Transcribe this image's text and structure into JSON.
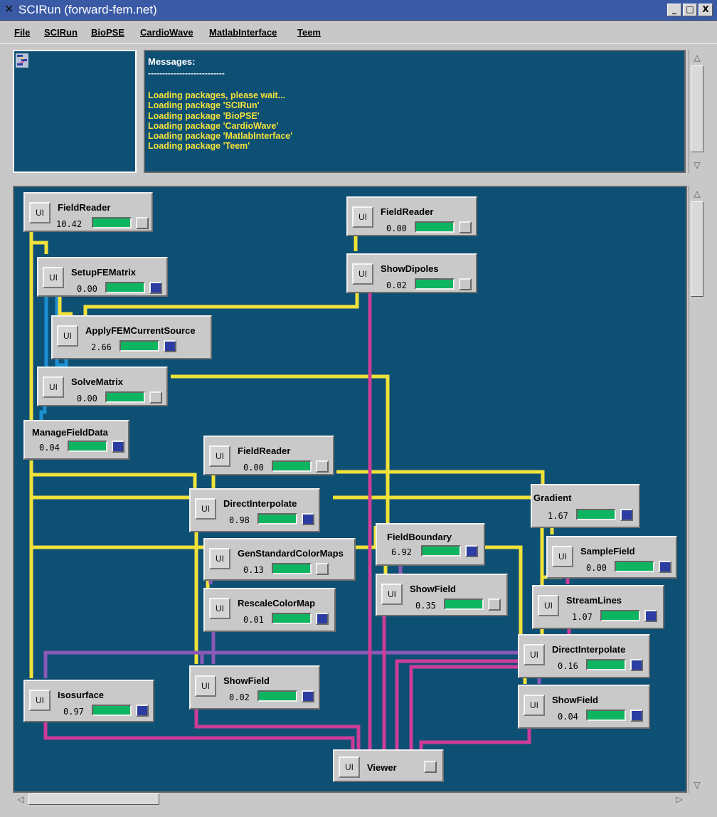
{
  "window": {
    "title": "SCIRun (forward-fem.net)",
    "controls": [
      "_",
      "□",
      "X"
    ]
  },
  "menu": [
    "File",
    "SCIRun",
    "BioPSE",
    "CardioWave",
    "MatlabInterface",
    "Teem"
  ],
  "messages": {
    "title": "Messages:",
    "rule": "---------------------------",
    "lines": [
      "Loading packages, please wait...",
      "Loading package 'SCIRun'",
      "Loading package 'BioPSE'",
      "Loading package 'CardioWave'",
      "Loading package 'MatlabInterface'",
      "Loading package 'Teem'"
    ]
  },
  "ui_label": "UI",
  "modules": {
    "field_reader_1": {
      "name": "FieldReader",
      "time": "10.42",
      "indicator": "grey"
    },
    "setup_fe_matrix": {
      "name": "SetupFEMatrix",
      "time": "0.00",
      "indicator": "blue"
    },
    "apply_fem_current_source": {
      "name": "ApplyFEMCurrentSource",
      "time": "2.66",
      "indicator": "blue"
    },
    "solve_matrix": {
      "name": "SolveMatrix",
      "time": "0.00",
      "indicator": "grey"
    },
    "manage_field_data": {
      "name": "ManageFieldData",
      "time": "0.04",
      "indicator": "blue"
    },
    "field_reader_2": {
      "name": "FieldReader",
      "time": "0.00",
      "indicator": "grey"
    },
    "show_dipoles": {
      "name": "ShowDipoles",
      "time": "0.02",
      "indicator": "grey"
    },
    "field_reader_3": {
      "name": "FieldReader",
      "time": "0.00",
      "indicator": "grey"
    },
    "direct_interpolate_1": {
      "name": "DirectInterpolate",
      "time": "0.98",
      "indicator": "blue"
    },
    "gen_standard_color_maps": {
      "name": "GenStandardColorMaps",
      "time": "0.13",
      "indicator": "grey"
    },
    "rescale_color_map": {
      "name": "RescaleColorMap",
      "time": "0.01",
      "indicator": "blue"
    },
    "show_field_1": {
      "name": "ShowField",
      "time": "0.02",
      "indicator": "blue"
    },
    "isosurface": {
      "name": "Isosurface",
      "time": "0.97",
      "indicator": "blue"
    },
    "field_boundary": {
      "name": "FieldBoundary",
      "time": "6.92",
      "indicator": "blue"
    },
    "show_field_2": {
      "name": "ShowField",
      "time": "0.35",
      "indicator": "grey"
    },
    "gradient": {
      "name": "Gradient",
      "time": "1.67",
      "indicator": "blue"
    },
    "sample_field": {
      "name": "SampleField",
      "time": "0.00",
      "indicator": "blue"
    },
    "stream_lines": {
      "name": "StreamLines",
      "time": "1.07",
      "indicator": "blue"
    },
    "direct_interpolate_2": {
      "name": "DirectInterpolate",
      "time": "0.16",
      "indicator": "blue"
    },
    "show_field_3": {
      "name": "ShowField",
      "time": "0.04",
      "indicator": "blue"
    },
    "viewer": {
      "name": "Viewer",
      "indicator": "grey"
    }
  },
  "colors": {
    "canvas": "#0e4f74",
    "field_wire": "#f0e23a",
    "matrix_wire": "#1d8fd0",
    "colormap_wire": "#8a5ab8",
    "geometry_wire": "#cc3d98",
    "progress": "#0eb561",
    "indicator_blue": "#2b3ca2"
  }
}
